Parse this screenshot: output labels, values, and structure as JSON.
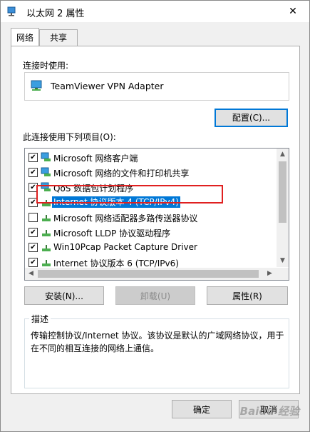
{
  "window": {
    "title": "以太网 2 属性",
    "close_glyph": "✕"
  },
  "tabs": [
    {
      "label": "网络",
      "active": true
    },
    {
      "label": "共享",
      "active": false
    }
  ],
  "connection": {
    "label": "连接时使用:",
    "adapter_name": "TeamViewer VPN Adapter",
    "configure_button": "配置(C)..."
  },
  "items_section": {
    "label": "此连接使用下列项目(O):",
    "items": [
      {
        "label": "Microsoft 网络客户端",
        "checked": true,
        "icon": "network-client-icon"
      },
      {
        "label": "Microsoft 网络的文件和打印机共享",
        "checked": true,
        "icon": "file-share-icon"
      },
      {
        "label": "QoS 数据包计划程序",
        "checked": true,
        "icon": "qos-icon"
      },
      {
        "label": "Internet 协议版本 4 (TCP/IPv4)",
        "checked": true,
        "icon": "protocol-icon",
        "selected": true
      },
      {
        "label": "Microsoft 网络适配器多路传送器协议",
        "checked": false,
        "icon": "protocol-icon"
      },
      {
        "label": "Microsoft LLDP 协议驱动程序",
        "checked": true,
        "icon": "protocol-icon"
      },
      {
        "label": "Win10Pcap Packet Capture Driver",
        "checked": true,
        "icon": "protocol-icon"
      },
      {
        "label": "Internet 协议版本 6 (TCP/IPv6)",
        "checked": true,
        "icon": "protocol-icon"
      }
    ]
  },
  "buttons": {
    "install": "安装(N)...",
    "uninstall": "卸载(U)",
    "properties": "属性(R)",
    "ok": "确定",
    "cancel": "取消"
  },
  "description": {
    "legend": "描述",
    "text": "传输控制协议/Internet 协议。该协议是默认的广域网络协议，用于在不同的相互连接的网络上通信。"
  },
  "watermark": "Baidu 经验",
  "colors": {
    "selection": "#0078d7",
    "highlight_box": "#e02020",
    "focus_border": "#0078d7"
  }
}
